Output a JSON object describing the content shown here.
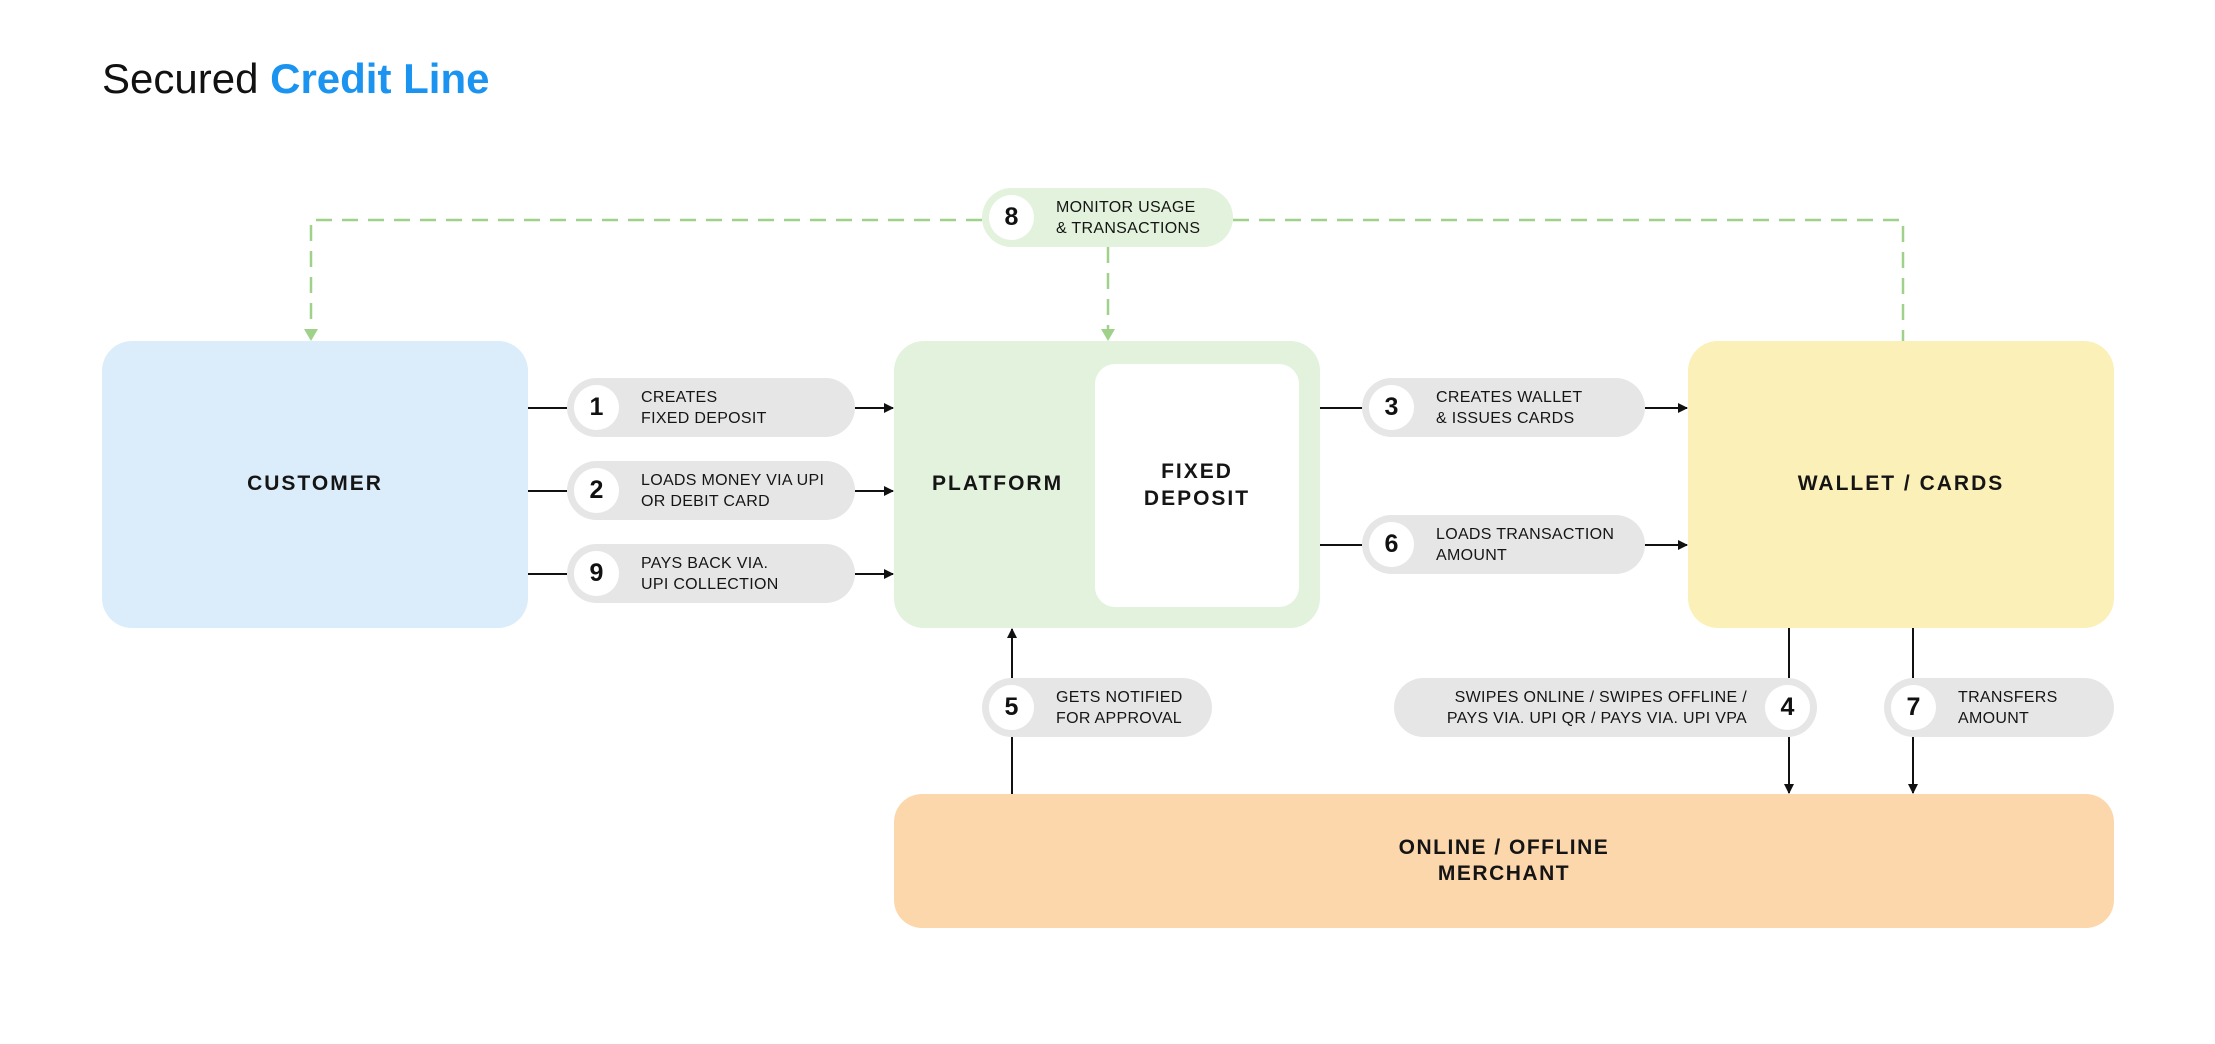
{
  "title": {
    "prefix": "Secured",
    "accent": "Credit Line",
    "accent_color": "#1a94f0"
  },
  "nodes": {
    "customer": {
      "label": "CUSTOMER",
      "color": "#dbedfa"
    },
    "platform": {
      "label": "PLATFORM",
      "color": "#e2f2dc"
    },
    "fixed_deposit": {
      "label": "FIXED\nDEPOSIT",
      "color": "#ffffff"
    },
    "wallet": {
      "label": "WALLET / CARDS",
      "color": "#fbf0b8"
    },
    "merchant": {
      "label": "ONLINE / OFFLINE\nMERCHANT",
      "color": "#fdd7ac"
    }
  },
  "steps": [
    {
      "num": "1",
      "text": "CREATES\nFIXED DEPOSIT",
      "from": "customer",
      "to": "platform"
    },
    {
      "num": "2",
      "text": "LOADS MONEY VIA UPI\nOR DEBIT CARD",
      "from": "customer",
      "to": "platform"
    },
    {
      "num": "3",
      "text": "CREATES WALLET\n& ISSUES CARDS",
      "from": "platform",
      "to": "wallet"
    },
    {
      "num": "4",
      "text": "SWIPES ONLINE / SWIPES OFFLINE /\nPAYS VIA. UPI QR / PAYS VIA. UPI VPA",
      "from": "wallet",
      "to": "merchant"
    },
    {
      "num": "5",
      "text": "GETS NOTIFIED\nFOR APPROVAL",
      "from": "merchant",
      "to": "platform"
    },
    {
      "num": "6",
      "text": "LOADS TRANSACTION\nAMOUNT",
      "from": "platform",
      "to": "wallet"
    },
    {
      "num": "7",
      "text": "TRANSFERS\nAMOUNT",
      "from": "wallet",
      "to": "merchant"
    },
    {
      "num": "8",
      "text": "MONITOR USAGE\n& TRANSACTIONS",
      "from": "monitor",
      "to": "customer, platform, wallet"
    },
    {
      "num": "9",
      "text": "PAYS BACK VIA.\nUPI COLLECTION",
      "from": "customer",
      "to": "platform"
    }
  ],
  "colors": {
    "arrow": "#111111",
    "monitor_dashed": "#9fd18a",
    "pill": "#e6e6e6",
    "pill_monitor": "#e2f2dc"
  }
}
